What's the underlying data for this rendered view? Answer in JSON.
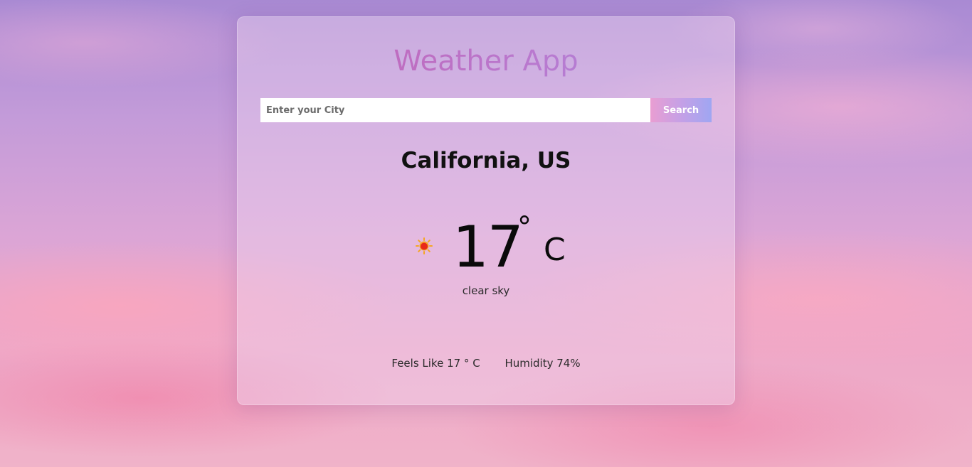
{
  "app": {
    "title": "Weather App"
  },
  "search": {
    "placeholder": "Enter your City",
    "value": "",
    "button_label": "Search"
  },
  "weather": {
    "location": "California, US",
    "temperature": "17",
    "degree_symbol": "°",
    "unit": "C",
    "condition": "clear sky",
    "icon": "sun-icon",
    "feels_like": "Feels Like 17 ° C",
    "humidity": "Humidity 74%"
  },
  "colors": {
    "title_gradient_start": "#c45fb0",
    "title_gradient_end": "#a98ae0",
    "button_gradient_start": "#e99ed2",
    "button_gradient_end": "#9fa6f2",
    "sun": "#e82a1a",
    "sun_rays": "#f5a623"
  }
}
